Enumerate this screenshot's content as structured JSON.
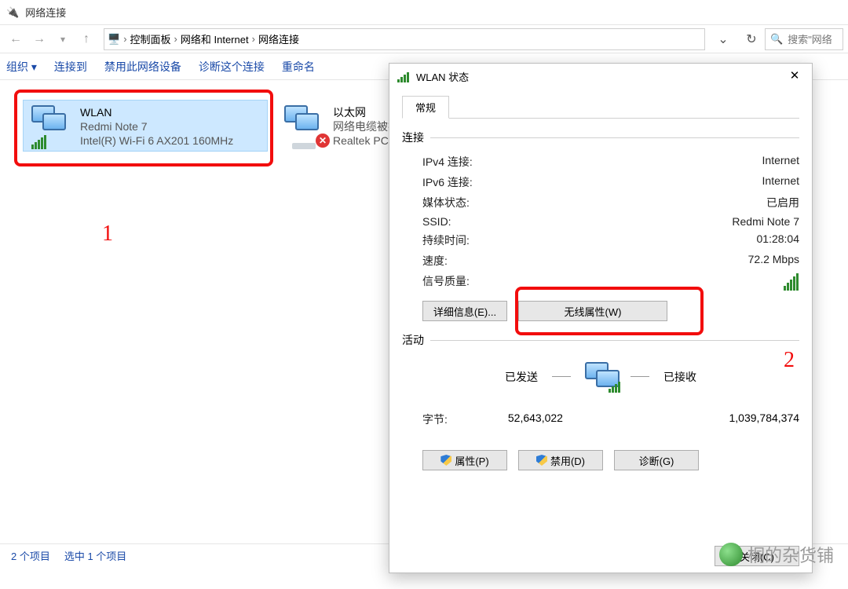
{
  "window_title": "网络连接",
  "breadcrumb": {
    "p1": "控制面板",
    "p2": "网络和 Internet",
    "p3": "网络连接"
  },
  "search_placeholder": "搜索\"网络",
  "cmdbar": {
    "org": "组织 ▾",
    "connect": "连接到",
    "disable": "禁用此网络设备",
    "diag": "诊断这个连接",
    "rename": "重命名"
  },
  "connections": {
    "wlan": {
      "name": "WLAN",
      "line2": "Redmi Note 7",
      "line3": "Intel(R) Wi-Fi 6 AX201 160MHz"
    },
    "ether": {
      "name": "以太网",
      "line2": "网络电缆被拔",
      "line3": "Realtek PCI"
    }
  },
  "status_bar": {
    "items": "2 个项目",
    "selected": "选中 1 个项目"
  },
  "annotations": {
    "one": "1",
    "two": "2"
  },
  "dialog": {
    "title": "WLAN 状态",
    "tab": "常规",
    "section_conn": "连接",
    "rows": {
      "ipv4_l": "IPv4 连接:",
      "ipv4_v": "Internet",
      "ipv6_l": "IPv6 连接:",
      "ipv6_v": "Internet",
      "media_l": "媒体状态:",
      "media_v": "已启用",
      "ssid_l": "SSID:",
      "ssid_v": "Redmi Note 7",
      "dur_l": "持续时间:",
      "dur_v": "01:28:04",
      "speed_l": "速度:",
      "speed_v": "72.2 Mbps",
      "sigq_l": "信号质量:"
    },
    "btn_details": "详细信息(E)...",
    "btn_wireless": "无线属性(W)",
    "section_activity": "活动",
    "activity": {
      "sent": "已发送",
      "recv": "已接收",
      "bytes_l": "字节:",
      "sent_v": "52,643,022",
      "recv_v": "1,039,784,374"
    },
    "btn_props": "属性(P)",
    "btn_disable": "禁用(D)",
    "btn_diag": "诊断(G)",
    "btn_close": "关闭(C)"
  },
  "watermark": "桐的杂货铺"
}
